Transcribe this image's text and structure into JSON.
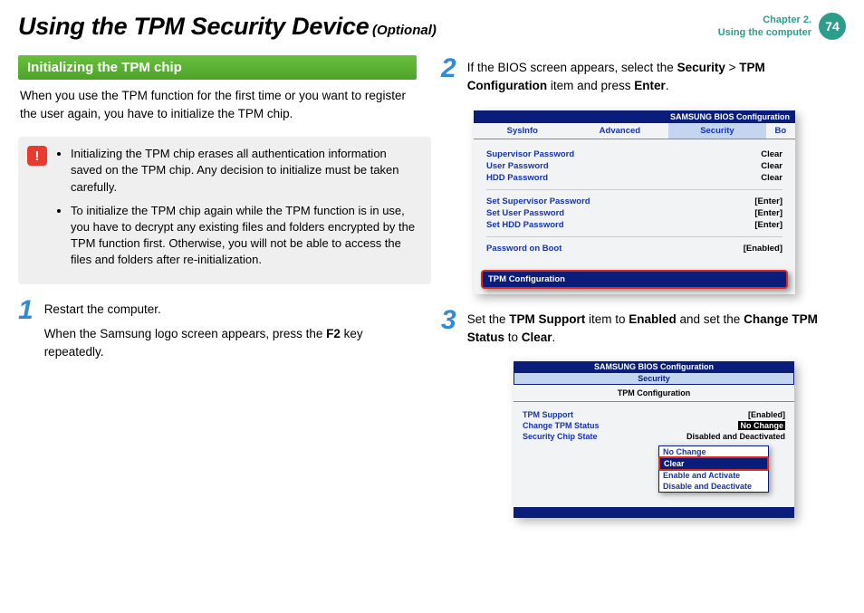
{
  "header": {
    "title": "Using the TPM Security Device",
    "subtitle": "(Optional)",
    "chapter": "Chapter 2.",
    "chapter_sub": "Using the computer",
    "page": "74"
  },
  "section_heading": "Initializing the TPM chip",
  "intro": "When you use the TPM function for the first time or you want to register the user again, you have to initialize the TPM chip.",
  "note": {
    "icon": "!",
    "bullet1": "Initializing the TPM chip erases all authentication information saved on the TPM chip. Any decision to initialize must be taken carefully.",
    "bullet2": "To initialize the TPM chip again while the TPM function is in use, you have to decrypt any existing files and folders encrypted by the TPM function first. Otherwise, you will not be able to access the files and folders after re-initialization."
  },
  "steps": {
    "s1": {
      "num": "1",
      "l1": "Restart the computer.",
      "l2a": "When the Samsung logo screen appears, press the ",
      "l2b": "F2",
      "l2c": " key repeatedly."
    },
    "s2": {
      "num": "2",
      "a": "If the BIOS screen appears, select the ",
      "b": "Security",
      "c": " > ",
      "d": "TPM Configuration",
      "e": " item and press ",
      "f": "Enter",
      "g": "."
    },
    "s3": {
      "num": "3",
      "a": "Set the ",
      "b": "TPM Support",
      "c": " item to ",
      "d": "Enabled",
      "e": " and set the ",
      "f": "Change TPM Status",
      "g": " to ",
      "h": "Clear",
      "i": "."
    }
  },
  "bios1": {
    "title": "SAMSUNG BIOS Configuration",
    "tabs": {
      "t1": "SysInfo",
      "t2": "Advanced",
      "t3": "Security",
      "t4": "Bo"
    },
    "rows": {
      "r1": {
        "l": "Supervisor Password",
        "v": "Clear"
      },
      "r2": {
        "l": "User Password",
        "v": "Clear"
      },
      "r3": {
        "l": "HDD Password",
        "v": "Clear"
      },
      "r4": {
        "l": "Set Supervisor Password",
        "v": "[Enter]"
      },
      "r5": {
        "l": "Set User Password",
        "v": "[Enter]"
      },
      "r6": {
        "l": "Set HDD Password",
        "v": "[Enter]"
      },
      "r7": {
        "l": "Password on Boot",
        "v": "[Enabled]"
      }
    },
    "highlight": "TPM Configuration"
  },
  "bios2": {
    "hdr": "SAMSUNG BIOS Configuration",
    "sub": "Security",
    "title": "TPM Configuration",
    "rows": {
      "r1": {
        "l": "TPM Support",
        "v": "[Enabled]"
      },
      "r2": {
        "l": "Change TPM Status",
        "v": "No Change"
      },
      "r3": {
        "l": "Security Chip State",
        "v": "Disabled and Deactivated"
      }
    },
    "dropdown": {
      "o1": "No Change",
      "o2": "Clear",
      "o3": "Enable and Activate",
      "o4": "Disable and Deactivate"
    }
  }
}
